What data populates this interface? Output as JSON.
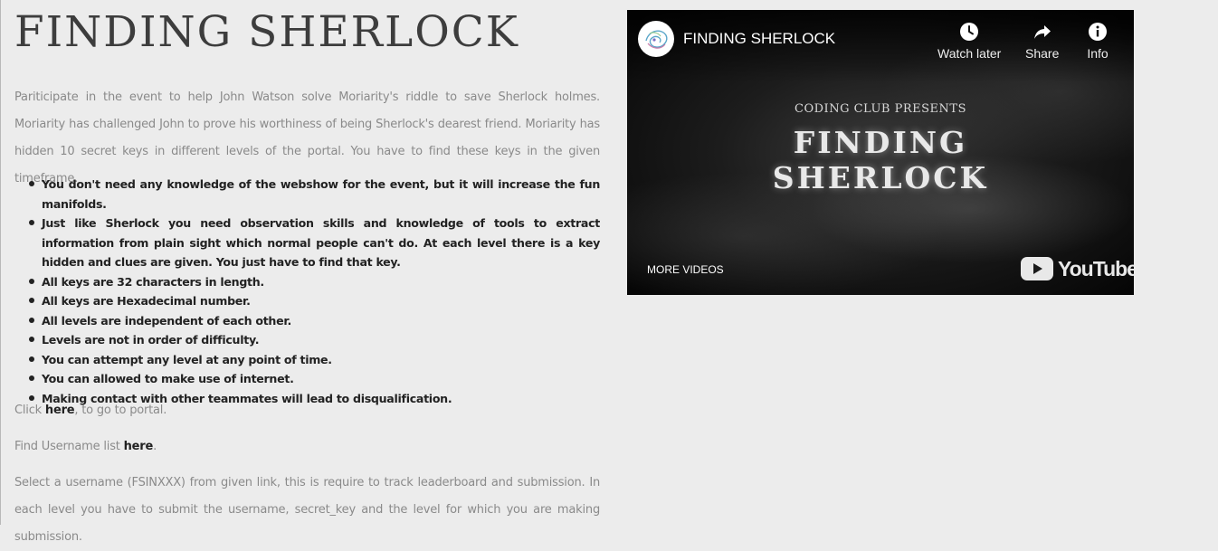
{
  "page": {
    "title": "FINDING SHERLOCK",
    "intro": "Pariticipate in the event to help John Watson solve Moriarity's riddle to save Sherlock holmes. Moriarity has challenged John to prove his worthiness of being Sherlock's dearest friend. Moriarity has hidden 10 secret keys in different levels of the portal. You have to find these keys in the given timeframe.",
    "rules": [
      "You don't need any knowledge of the webshow for the event, but it will increase the fun manifolds.",
      "Just like Sherlock you need observation skills and knowledge of tools to extract information from plain sight which normal people can't do. At each level there is a key hidden and clues are given. You just have to find that key.",
      "All keys are 32 characters in length.",
      "All keys are Hexadecimal number.",
      "All levels are independent of each other.",
      "Levels are not in order of difficulty.",
      "You can attempt any level at any point of time.",
      "You can allowed to make use of internet.",
      "Making contact with other teammates will lead to disqualification."
    ],
    "portal_prefix": "Click ",
    "portal_link": "here",
    "portal_suffix": ", to go to portal.",
    "username_prefix": "Find Username list ",
    "username_link": "here",
    "username_suffix": ".",
    "select_text": "Select a username (FSINXXX) from given link, this is require to track leaderboard and submission. In each level you have to submit the username, secret_key and the level for which you are making submission."
  },
  "video": {
    "title": "FINDING SHERLOCK",
    "actions": {
      "watch_later": "Watch later",
      "share": "Share",
      "info": "Info"
    },
    "thumbnail_subtitle": "CODING CLUB PRESENTS",
    "thumbnail_line1": "FINDING",
    "thumbnail_line2": "SHERLOCK",
    "more_videos": "MORE VIDEOS",
    "logo_text": "YouTube",
    "icons": {
      "avatar": "channel-avatar",
      "watch_later": "clock-icon",
      "share": "share-arrow-icon",
      "info": "info-icon",
      "logo": "youtube-play-icon"
    }
  },
  "colors": {
    "background": "#ececec",
    "title": "#3d3d3d",
    "muted_text": "#8a8a8a",
    "bold_text": "#222222",
    "video_bg": "#111111"
  }
}
